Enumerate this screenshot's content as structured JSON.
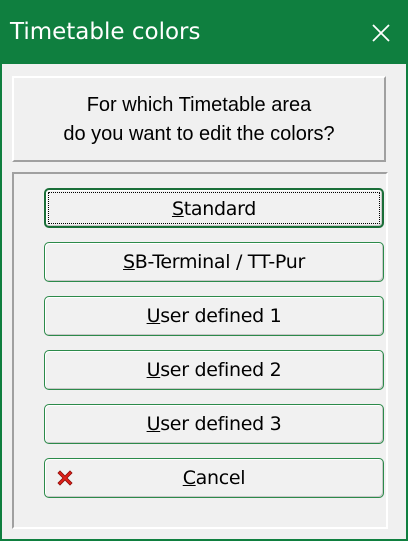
{
  "window": {
    "title": "Timetable colors",
    "close_glyph": "✕"
  },
  "question": {
    "line1": "For which Timetable area",
    "line2": "do you want to edit the colors?"
  },
  "buttons": [
    {
      "mnemonic": "S",
      "rest": "tandard",
      "label": "Standard"
    },
    {
      "mnemonic": "S",
      "rest": "B-Terminal / TT-Pur",
      "label": "SB-Terminal / TT-Pur"
    },
    {
      "mnemonic": "U",
      "rest": "ser defined 1",
      "label": "User defined 1"
    },
    {
      "mnemonic": "U",
      "rest": "ser defined 2",
      "label": "User defined 2"
    },
    {
      "mnemonic": "U",
      "rest": "ser defined 3",
      "label": "User defined 3"
    },
    {
      "mnemonic": "C",
      "rest": "ancel",
      "label": "Cancel",
      "icon": "red-x-icon"
    }
  ],
  "colors": {
    "titlebar": "#0f7f3f",
    "cancel_icon": "#e0201a"
  }
}
